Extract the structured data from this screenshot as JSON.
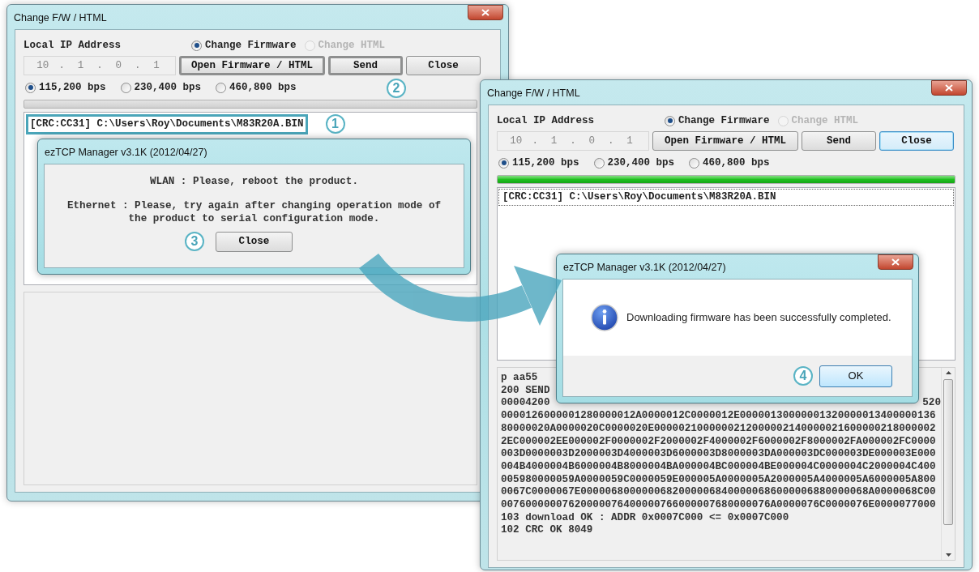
{
  "windows": [
    {
      "title": "Change F/W / HTML",
      "local_ip_label": "Local IP Address",
      "ip_octets": [
        "10",
        "1",
        "0",
        "1"
      ],
      "ip_separator": ".",
      "mode_options": [
        {
          "label": "Change Firmware",
          "selected": true,
          "disabled": false
        },
        {
          "label": "Change HTML",
          "selected": false,
          "disabled": true
        }
      ],
      "buttons": [
        {
          "label": "Open Firmware / HTML",
          "highlighted": true,
          "focused": false
        },
        {
          "label": "Send",
          "highlighted": true,
          "focused": false,
          "callout": "2"
        },
        {
          "label": "Close",
          "highlighted": false,
          "focused": false
        }
      ],
      "baud_options": [
        {
          "label": "115,200 bps",
          "selected": true
        },
        {
          "label": "230,400 bps",
          "selected": false
        },
        {
          "label": "460,800 bps",
          "selected": false
        }
      ],
      "progress": {
        "level": 0
      },
      "files": [
        {
          "text": "[CRC:CC31] C:\\Users\\Roy\\Documents\\M83R20A.BIN",
          "highlighted": true,
          "callout": "1"
        }
      ],
      "dialog": {
        "kind": "notice",
        "title": "ezTCP Manager v3.1K (2012/04/27)",
        "lines": [
          "WLAN : Please, reboot the product.",
          "Ethernet : Please, try again after changing operation mode of the product to serial configuration mode."
        ],
        "button": {
          "label": "Close",
          "callout": "3"
        }
      }
    },
    {
      "title": "Change F/W / HTML",
      "local_ip_label": "Local IP Address",
      "ip_octets": [
        "10",
        "1",
        "0",
        "1"
      ],
      "ip_separator": ".",
      "mode_options": [
        {
          "label": "Change Firmware",
          "selected": true,
          "disabled": false
        },
        {
          "label": "Change HTML",
          "selected": false,
          "disabled": true
        }
      ],
      "buttons": [
        {
          "label": "Open Firmware / HTML",
          "highlighted": false,
          "focused": false
        },
        {
          "label": "Send",
          "highlighted": false,
          "focused": false
        },
        {
          "label": "Close",
          "highlighted": false,
          "focused": true
        }
      ],
      "baud_options": [
        {
          "label": "115,200 bps",
          "selected": true
        },
        {
          "label": "230,400 bps",
          "selected": false
        },
        {
          "label": "460,800 bps",
          "selected": false
        }
      ],
      "progress": {
        "level": 1
      },
      "files": [
        {
          "text": "[CRC:CC31] C:\\Users\\Roy\\Documents\\M83R20A.BIN",
          "selected": true
        }
      ],
      "log_lines": [
        {
          "text": "p aa55"
        },
        {
          "text": "200 SEND"
        },
        {
          "text": "00004200",
          "end": "520"
        },
        {
          "text": "0000126000001280000012A0000012C0000012E00000130000001320000013400000136"
        },
        {
          "text": "80000020A0000020C0000020E0000021000000212000002140000021600000218000002"
        },
        {
          "text": "2EC000002EE000002F0000002F2000002F4000002F6000002F8000002FA000002FC0000"
        },
        {
          "text": "003D0000003D2000003D4000003D6000003D8000003DA000003DC000003DE000003E000"
        },
        {
          "text": "004B4000004B6000004B8000004BA000004BC000004BE000004C0000004C2000004C400"
        },
        {
          "text": "005980000059A0000059C0000059E000005A0000005A2000005A4000005A6000005A800"
        },
        {
          "text": "0067C0000067E00000680000006820000068400000686000006880000068A0000068C00"
        },
        {
          "text": "00760000007620000076400000766000007680000076A0000076C0000076E0000077000"
        },
        {
          "text": "103 download OK : ADDR 0x0007C000 <= 0x0007C000"
        },
        {
          "text": "102 CRC OK 8049"
        }
      ],
      "dialog": {
        "kind": "info",
        "title": "ezTCP Manager v3.1K (2012/04/27)",
        "message": "Downloading firmware has been successfully completed.",
        "button": {
          "label": "OK",
          "callout": "4"
        }
      }
    }
  ]
}
